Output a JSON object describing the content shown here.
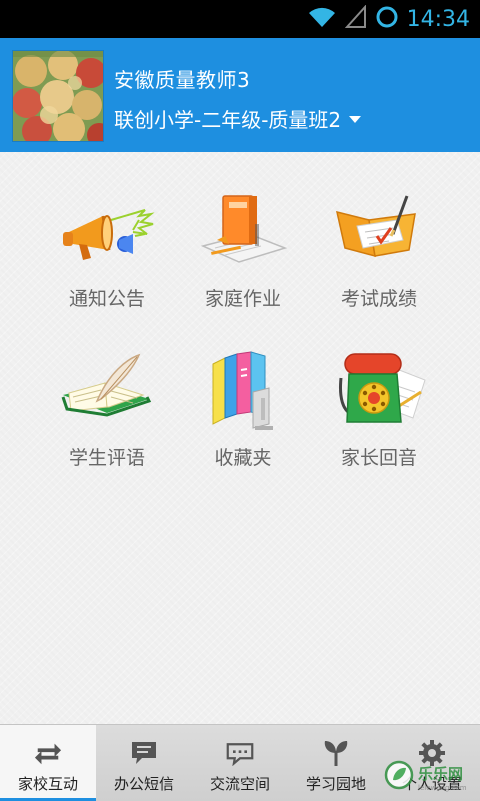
{
  "status_bar": {
    "time": "14:34",
    "icons": [
      "wifi-icon",
      "signal-icon",
      "sync-ring-icon"
    ]
  },
  "header": {
    "title": "安徽质量教师3",
    "class_selector": "联创小学-二年级-质量班2"
  },
  "grid": {
    "items": [
      {
        "label": "通知公告",
        "icon": "megaphone-icon"
      },
      {
        "label": "家庭作业",
        "icon": "homework-book-icon"
      },
      {
        "label": "考试成绩",
        "icon": "exam-folder-icon"
      },
      {
        "label": "学生评语",
        "icon": "quill-book-icon"
      },
      {
        "label": "收藏夹",
        "icon": "bookshelf-icon"
      },
      {
        "label": "家长回音",
        "icon": "telephone-icon"
      }
    ]
  },
  "bottom_nav": {
    "items": [
      {
        "label": "家校互动",
        "icon": "swap-arrows-icon",
        "active": true
      },
      {
        "label": "办公短信",
        "icon": "sms-bubble-icon",
        "active": false
      },
      {
        "label": "交流空间",
        "icon": "chat-dots-icon",
        "active": false
      },
      {
        "label": "学习园地",
        "icon": "sprout-icon",
        "active": false
      },
      {
        "label": "个人设置",
        "icon": "gear-icon",
        "active": false
      }
    ]
  },
  "watermark": {
    "text": "乐乐网",
    "sub": "lelewang.com"
  },
  "colors": {
    "header": "#1e8fe0",
    "status_accent": "#33b5e5",
    "label": "#666666"
  }
}
